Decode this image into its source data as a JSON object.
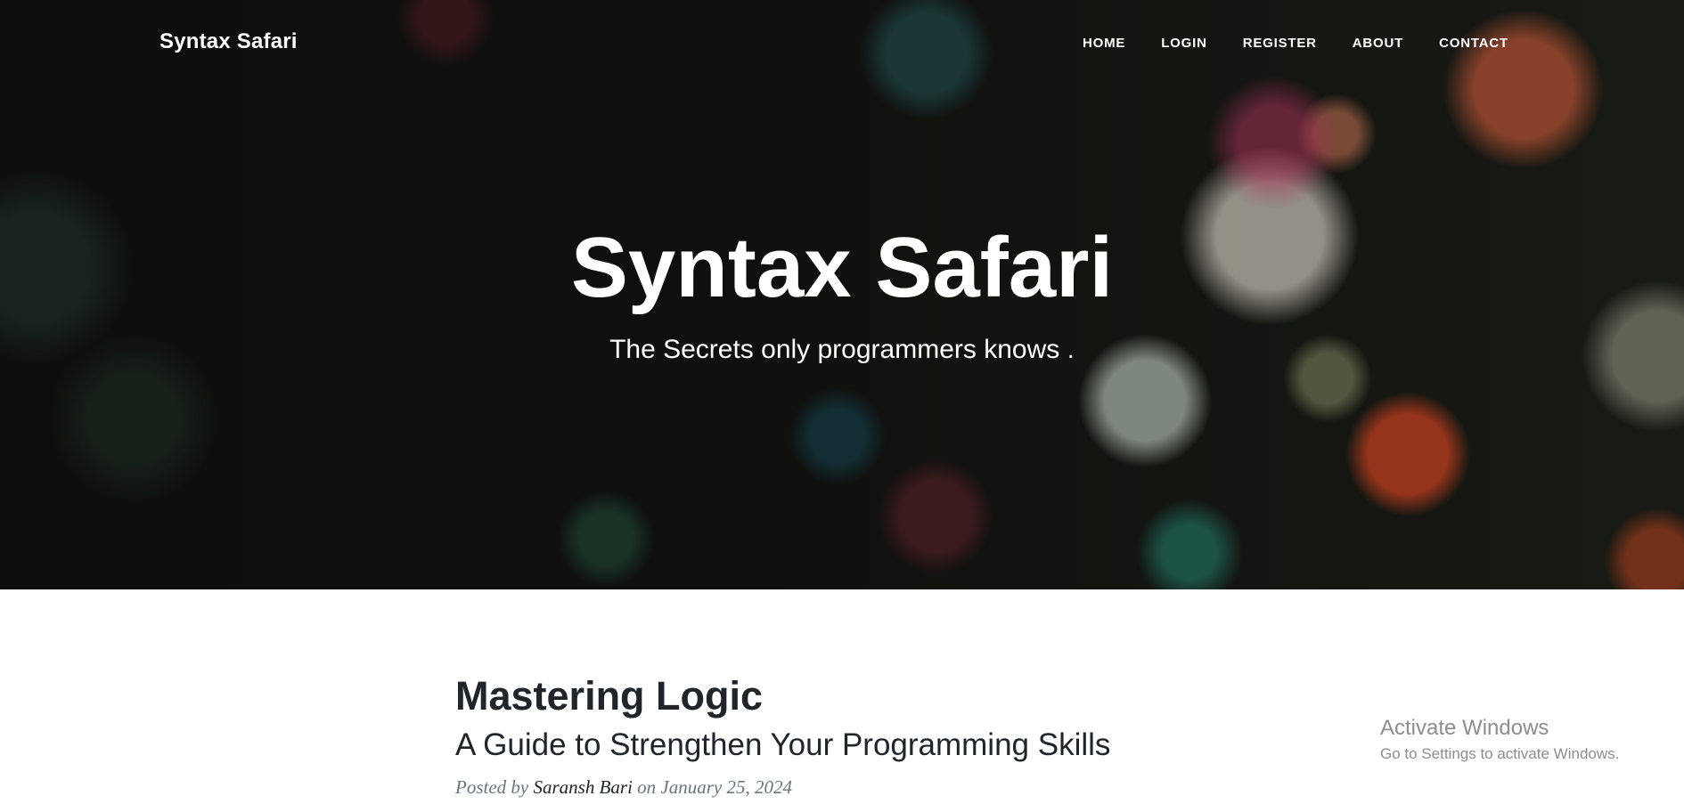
{
  "navbar": {
    "brand": "Syntax Safari",
    "links": [
      "HOME",
      "LOGIN",
      "REGISTER",
      "ABOUT",
      "CONTACT"
    ]
  },
  "hero": {
    "title": "Syntax Safari",
    "subtitle": "The Secrets only programmers knows ."
  },
  "post": {
    "title": "Mastering Logic",
    "subtitle": "A Guide to Strengthen Your Programming Skills",
    "meta_prefix": "Posted by",
    "author": "Saransh Bari",
    "meta_middle": "on",
    "date": "January 25, 2024"
  },
  "watermark": {
    "title": "Activate Windows",
    "subtitle": "Go to Settings to activate Windows."
  },
  "colors": {
    "text_dark": "#212529",
    "text_muted": "#6c757d",
    "hero_text": "#ffffff"
  }
}
